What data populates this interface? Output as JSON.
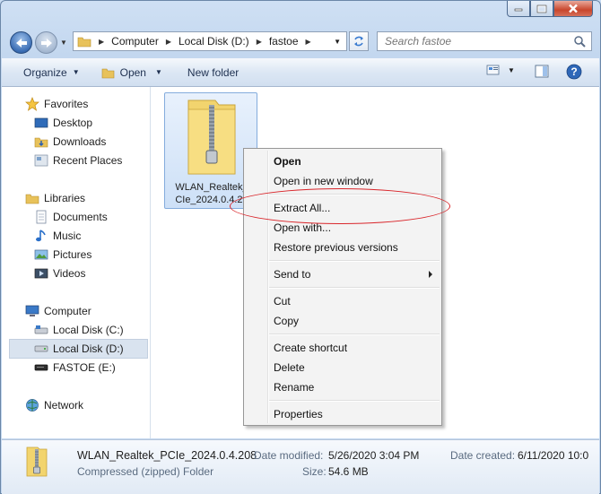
{
  "window": {
    "caption": {
      "minimize": "minimize",
      "maximize": "maximize",
      "close": "close"
    }
  },
  "address": {
    "crumbs": [
      "Computer",
      "Local Disk (D:)",
      "fastoe"
    ]
  },
  "search": {
    "placeholder": "Search fastoe"
  },
  "toolbar": {
    "organize": "Organize",
    "open": "Open",
    "new_folder": "New folder"
  },
  "nav": {
    "favorites": {
      "label": "Favorites",
      "items": [
        "Desktop",
        "Downloads",
        "Recent Places"
      ]
    },
    "libraries": {
      "label": "Libraries",
      "items": [
        "Documents",
        "Music",
        "Pictures",
        "Videos"
      ]
    },
    "computer": {
      "label": "Computer",
      "items": [
        "Local Disk (C:)",
        "Local Disk (D:)",
        "FASTOE (E:)"
      ],
      "selected": "Local Disk (D:)"
    },
    "network": {
      "label": "Network"
    }
  },
  "file": {
    "name_line1": "WLAN_Realtek_",
    "name_line2": "CIe_2024.0.4.20"
  },
  "context_menu": {
    "group1": [
      "Open",
      "Open in new window",
      "Extract All...",
      "Open with...",
      "Restore previous versions"
    ],
    "send_to": "Send to",
    "group2": [
      "Cut",
      "Copy"
    ],
    "group3": [
      "Create shortcut",
      "Delete",
      "Rename"
    ],
    "group4": [
      "Properties"
    ],
    "highlighted": "Extract All..."
  },
  "details": {
    "filename": "WLAN_Realtek_PCIe_2024.0.4.208",
    "type": "Compressed (zipped) Folder",
    "date_modified_label": "Date modified:",
    "date_modified": "5/26/2020 3:04 PM",
    "size_label": "Size:",
    "size": "54.6 MB",
    "date_created_label": "Date created:",
    "date_created": "6/11/2020 10:0"
  },
  "colors": {
    "highlight_ellipse": "#d9262b",
    "selected_nav": "#d9e3ef"
  }
}
